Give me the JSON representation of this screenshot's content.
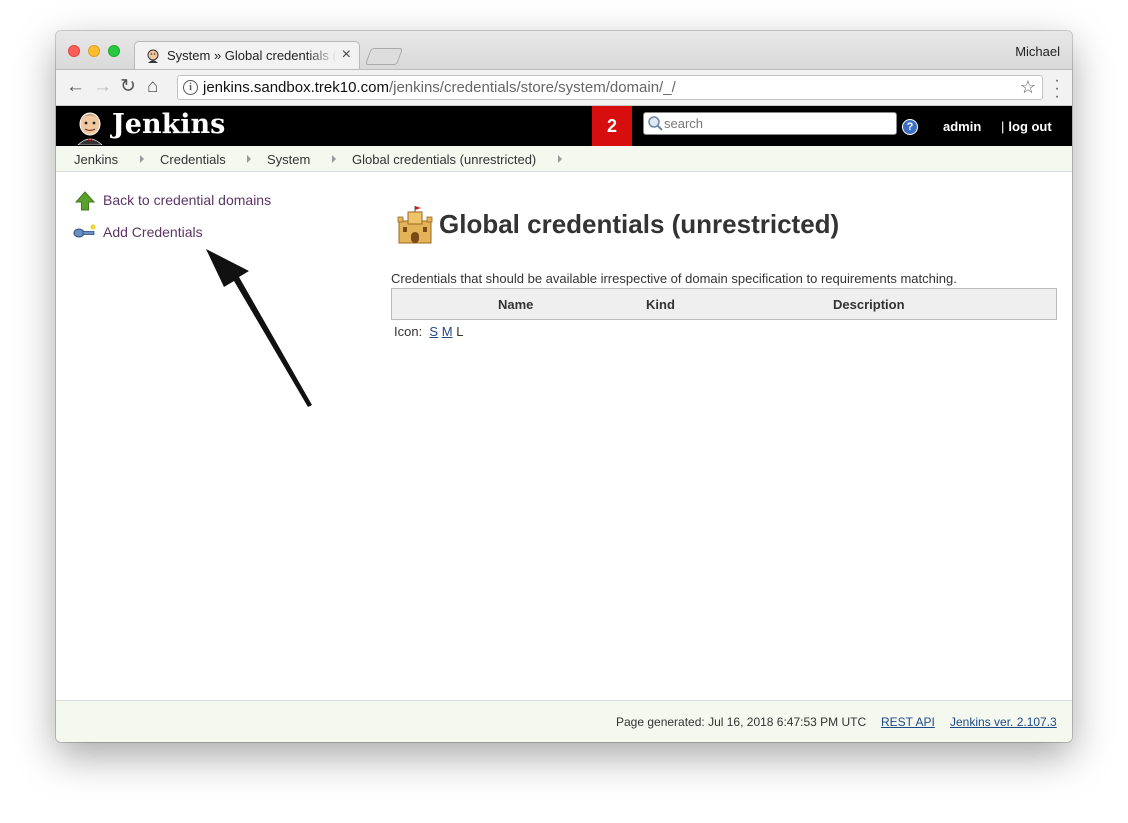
{
  "browser": {
    "tab_title": "System » Global credentials (unrestricted)",
    "profile_name": "Michael",
    "url_host": "jenkins.sandbox.trek10.com",
    "url_path": "/jenkins/credentials/store/system/domain/_/"
  },
  "header": {
    "brand": "Jenkins",
    "notification_count": "2",
    "search_placeholder": "search",
    "help_label": "?",
    "user": "admin",
    "pipe": "|",
    "logout": "log out"
  },
  "breadcrumbs": [
    "Jenkins",
    "Credentials",
    "System",
    "Global credentials (unrestricted)"
  ],
  "sidebar": {
    "items": [
      {
        "label": "Back to credential domains",
        "icon": "up-arrow-icon"
      },
      {
        "label": "Add Credentials",
        "icon": "key-icon"
      }
    ]
  },
  "main": {
    "title": "Global credentials (unrestricted)",
    "description": "Credentials that should be available irrespective of domain specification to requirements matching.",
    "table_headers": [
      "Name",
      "Kind",
      "Description"
    ],
    "icon_label": "Icon:",
    "icon_sizes": [
      "S",
      "M",
      "L"
    ]
  },
  "footer": {
    "generated": "Page generated: Jul 16, 2018 6:47:53 PM UTC",
    "rest_api": "REST API",
    "version": "Jenkins ver. 2.107.3"
  },
  "colors": {
    "header_bg": "#000000",
    "badge_bg": "#d80e0e",
    "link": "#5c3566",
    "breadcrumb_bg": "#f5f8ee"
  }
}
